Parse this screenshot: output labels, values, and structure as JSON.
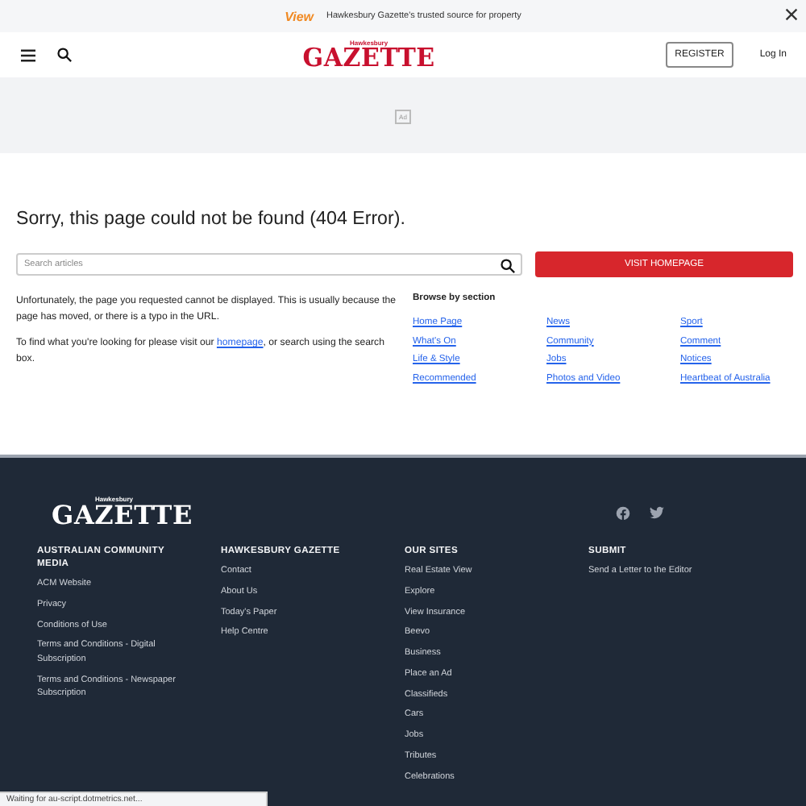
{
  "promo": {
    "logo": "View",
    "text": "Hawkesbury Gazette's trusted source for property"
  },
  "header": {
    "brand_small": "Hawkesbury",
    "brand": "GAZETTE",
    "register": "REGISTER",
    "login": "Log In"
  },
  "ad": {
    "label": "Ad"
  },
  "error": {
    "title": "Sorry, this page could not be found (404 Error).",
    "search": {
      "placeholder": "Search articles"
    },
    "button": "VISIT HOMEPAGE",
    "paragraph_1": "Unfortunately, the page you requested cannot be displayed. This is usually because the page has moved, or there is a typo in the URL.",
    "paragraph_2": {
      "before": "To find what you're looking for please visit our ",
      "link": "homepage",
      "after": ", or search using the search box."
    },
    "browse": {
      "heading": "Browse by section",
      "links": [
        "Home Page",
        "News",
        "Sport",
        "What's On",
        "Community",
        "Comment",
        "Life & Style",
        "Jobs",
        "Notices",
        "Recommended",
        "Photos and Video",
        "Heartbeat of Australia"
      ]
    }
  },
  "footer": {
    "brand_small": "Hawkesbury",
    "brand": "GAZETTE",
    "columns": [
      {
        "heading": "AUSTRALIAN COMMUNITY MEDIA",
        "links": [
          "ACM Website",
          "Privacy",
          "Conditions of Use",
          "Terms and Conditions - Digital Subscription",
          "Terms and Conditions - Newspaper Subscription"
        ]
      },
      {
        "heading": "HAWKESBURY GAZETTE",
        "links": [
          "Contact",
          "About Us",
          "Today's Paper",
          "Help Centre"
        ]
      },
      {
        "heading": "OUR SITES",
        "links": [
          "Real Estate View",
          "Explore",
          "View Insurance",
          "Beevo",
          "Business",
          "Place an Ad",
          "Classifieds",
          "Cars",
          "Jobs",
          "Tributes",
          "Celebrations"
        ]
      },
      {
        "heading": "SUBMIT",
        "links": [
          "Send a Letter to the Editor"
        ]
      }
    ]
  },
  "status": "Waiting for au-script.dotmetrics.net..."
}
